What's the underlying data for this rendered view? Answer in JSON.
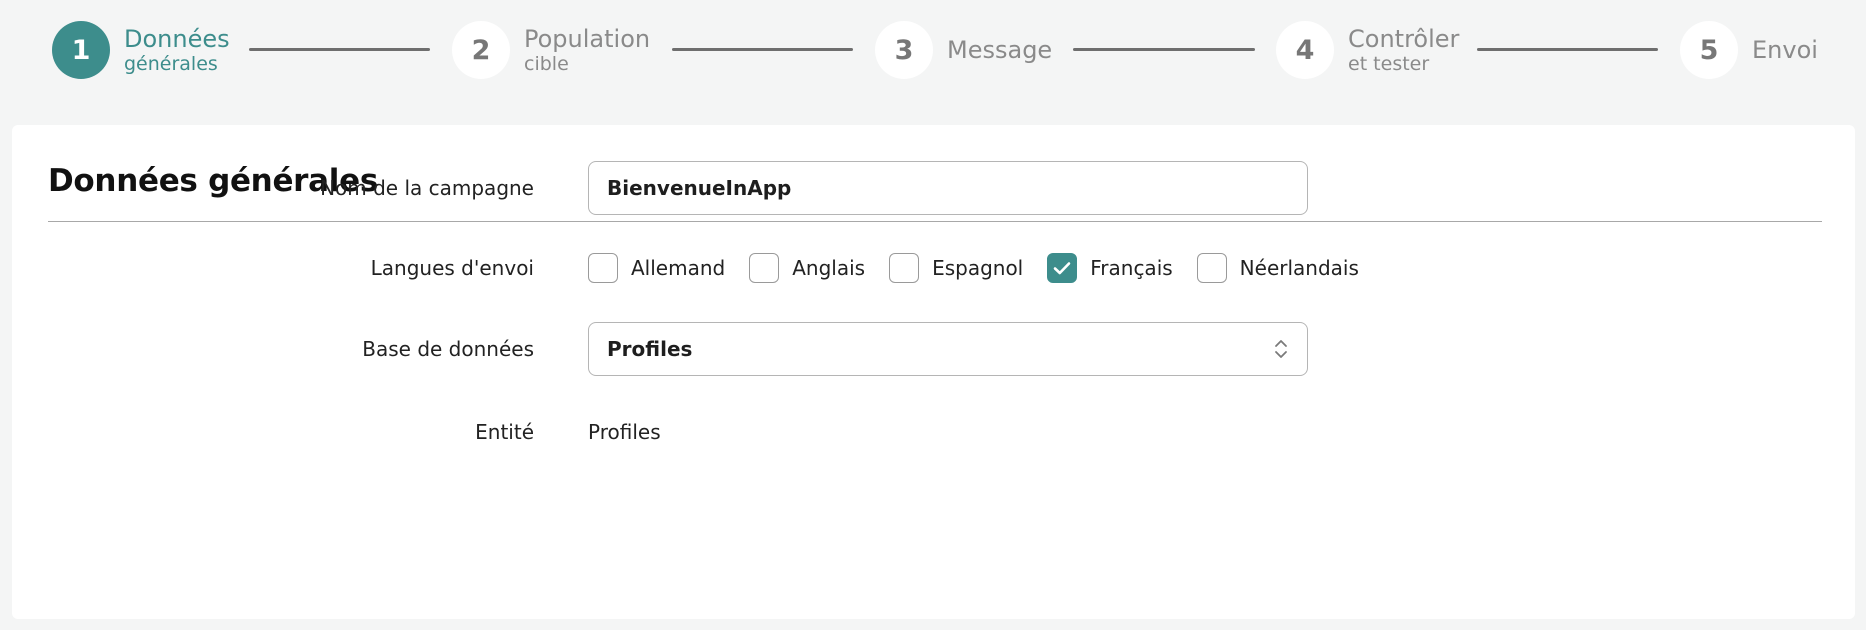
{
  "stepper": {
    "steps": [
      {
        "number": "1",
        "label": "Données",
        "sub": "générales",
        "active": true
      },
      {
        "number": "2",
        "label": "Population",
        "sub": "cible",
        "active": false
      },
      {
        "number": "3",
        "label": "Message",
        "sub": "",
        "active": false
      },
      {
        "number": "4",
        "label": "Contrôler",
        "sub": "et tester",
        "active": false
      },
      {
        "number": "5",
        "label": "Envoi",
        "sub": "",
        "active": false
      }
    ]
  },
  "card": {
    "title": "Données générales"
  },
  "form": {
    "campaign_name": {
      "label": "Nom de la campagne",
      "value": "BienvenueInApp"
    },
    "languages": {
      "label": "Langues d'envoi",
      "options": [
        {
          "label": "Allemand",
          "checked": false
        },
        {
          "label": "Anglais",
          "checked": false
        },
        {
          "label": "Espagnol",
          "checked": false
        },
        {
          "label": "Français",
          "checked": true
        },
        {
          "label": "Néerlandais",
          "checked": false
        }
      ]
    },
    "database": {
      "label": "Base de données",
      "value": "Profiles"
    },
    "entity": {
      "label": "Entité",
      "value": "Profiles"
    }
  },
  "colors": {
    "accent": "#3d8d8c",
    "background": "#f4f5f5",
    "card": "#ffffff",
    "inactive_text": "#8a8a8a"
  },
  "icons": {
    "checkbox_checked": "check-icon",
    "select_arrows": "chevron-up-down-icon"
  }
}
